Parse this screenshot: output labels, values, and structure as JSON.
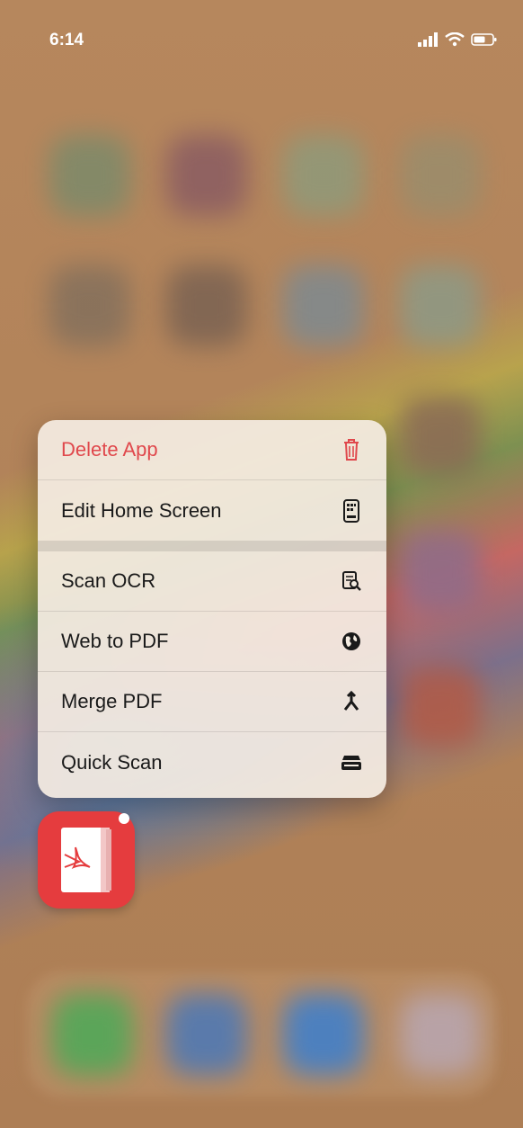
{
  "status_bar": {
    "time": "6:14",
    "icons": [
      "signal-icon",
      "wifi-icon",
      "battery-icon"
    ]
  },
  "context_menu": {
    "items": [
      {
        "label": "Delete App",
        "icon": "trash-icon",
        "style": "destructive"
      },
      {
        "label": "Edit Home Screen",
        "icon": "phone-apps-icon",
        "style": "normal"
      },
      {
        "label": "Scan OCR",
        "icon": "doc-magnify-icon",
        "style": "normal"
      },
      {
        "label": "Web to PDF",
        "icon": "globe-icon",
        "style": "normal"
      },
      {
        "label": "Merge PDF",
        "icon": "merge-arrows-icon",
        "style": "normal"
      },
      {
        "label": "Quick Scan",
        "icon": "scanner-icon",
        "style": "normal"
      }
    ]
  },
  "app": {
    "name": "PDF app",
    "icon": "pdf-app-icon",
    "accent": "#e53c3e"
  },
  "colors": {
    "destructive": "#e0484c",
    "menu_bg": "#f4ece2",
    "wallpaper": "#b0825a"
  }
}
